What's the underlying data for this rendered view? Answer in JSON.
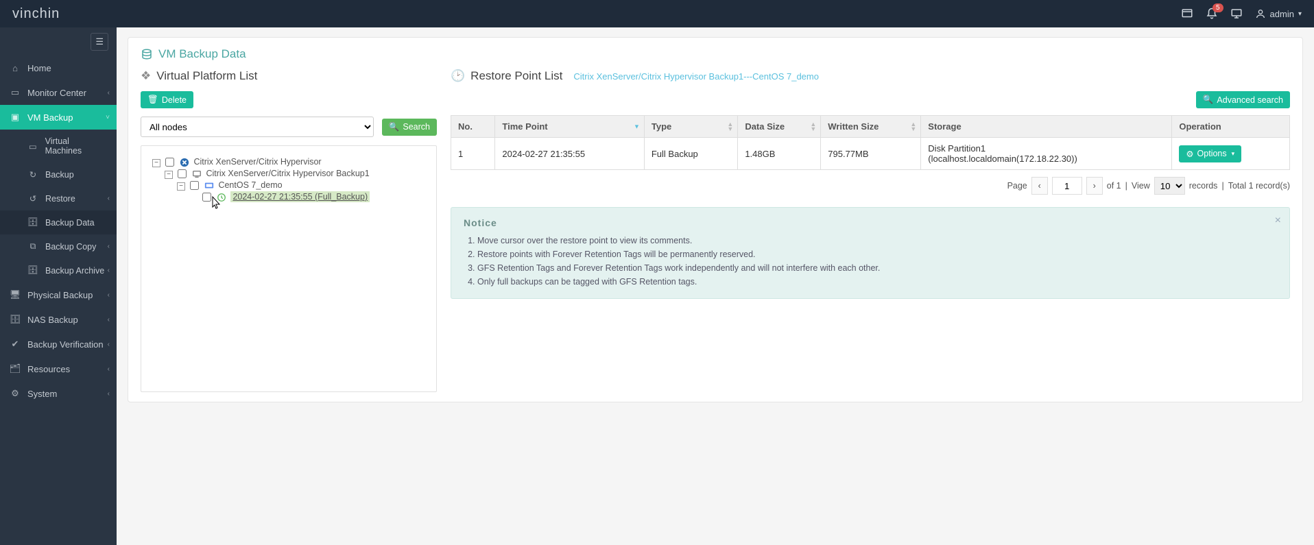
{
  "brand": {
    "part1": "vin",
    "part2": "chin"
  },
  "topbar": {
    "notification_count": "5",
    "username": "admin"
  },
  "sidebar": {
    "items": [
      {
        "label": "Home"
      },
      {
        "label": "Monitor Center",
        "chev": true
      },
      {
        "label": "VM Backup",
        "chev": true,
        "active": true
      },
      {
        "label": "Virtual Machines",
        "indent": true
      },
      {
        "label": "Backup",
        "indent": true
      },
      {
        "label": "Restore",
        "indent": true,
        "chev": true
      },
      {
        "label": "Backup Data",
        "indent": true,
        "selected": true
      },
      {
        "label": "Backup Copy",
        "indent": true,
        "chev": true
      },
      {
        "label": "Backup Archive",
        "indent": true,
        "chev": true
      },
      {
        "label": "Physical Backup",
        "chev": true
      },
      {
        "label": "NAS Backup",
        "chev": true
      },
      {
        "label": "Backup Verification",
        "chev": true
      },
      {
        "label": "Resources",
        "chev": true
      },
      {
        "label": "System",
        "chev": true
      }
    ]
  },
  "page": {
    "title": "VM Backup Data"
  },
  "left": {
    "title": "Virtual Platform List",
    "delete_label": "Delete",
    "node_select": "All nodes",
    "search_label": "Search",
    "tree": {
      "l1": "Citrix XenServer/Citrix Hypervisor",
      "l2": "Citrix XenServer/Citrix Hypervisor Backup1",
      "l3": "CentOS 7_demo",
      "l4": "2024-02-27 21:35:55 (Full_Backup)"
    }
  },
  "right": {
    "title": "Restore Point List",
    "subtitle": "Citrix XenServer/Citrix Hypervisor Backup1---CentOS 7_demo",
    "adv_search": "Advanced search",
    "cols": {
      "no": "No.",
      "time": "Time Point",
      "type": "Type",
      "size": "Data Size",
      "written": "Written Size",
      "storage": "Storage",
      "op": "Operation"
    },
    "row": {
      "no": "1",
      "time": "2024-02-27 21:35:55",
      "type": "Full Backup",
      "size": "1.48GB",
      "written": "795.77MB",
      "storage_line1": "Disk Partition1",
      "storage_line2": "(localhost.localdomain(172.18.22.30))",
      "options": "Options"
    },
    "pager": {
      "page_label": "Page",
      "page_val": "1",
      "of_label": "of 1",
      "view_label": "View",
      "view_val": "10",
      "records_label": "records",
      "total_label": "Total 1 record(s)"
    }
  },
  "notice": {
    "title": "Notice",
    "items": [
      "Move cursor over the restore point to view its comments.",
      "Restore points with Forever Retention Tags will be permanently reserved.",
      "GFS Retention Tags and Forever Retention Tags work independently and will not interfere with each other.",
      "Only full backups can be tagged with GFS Retention tags."
    ]
  }
}
